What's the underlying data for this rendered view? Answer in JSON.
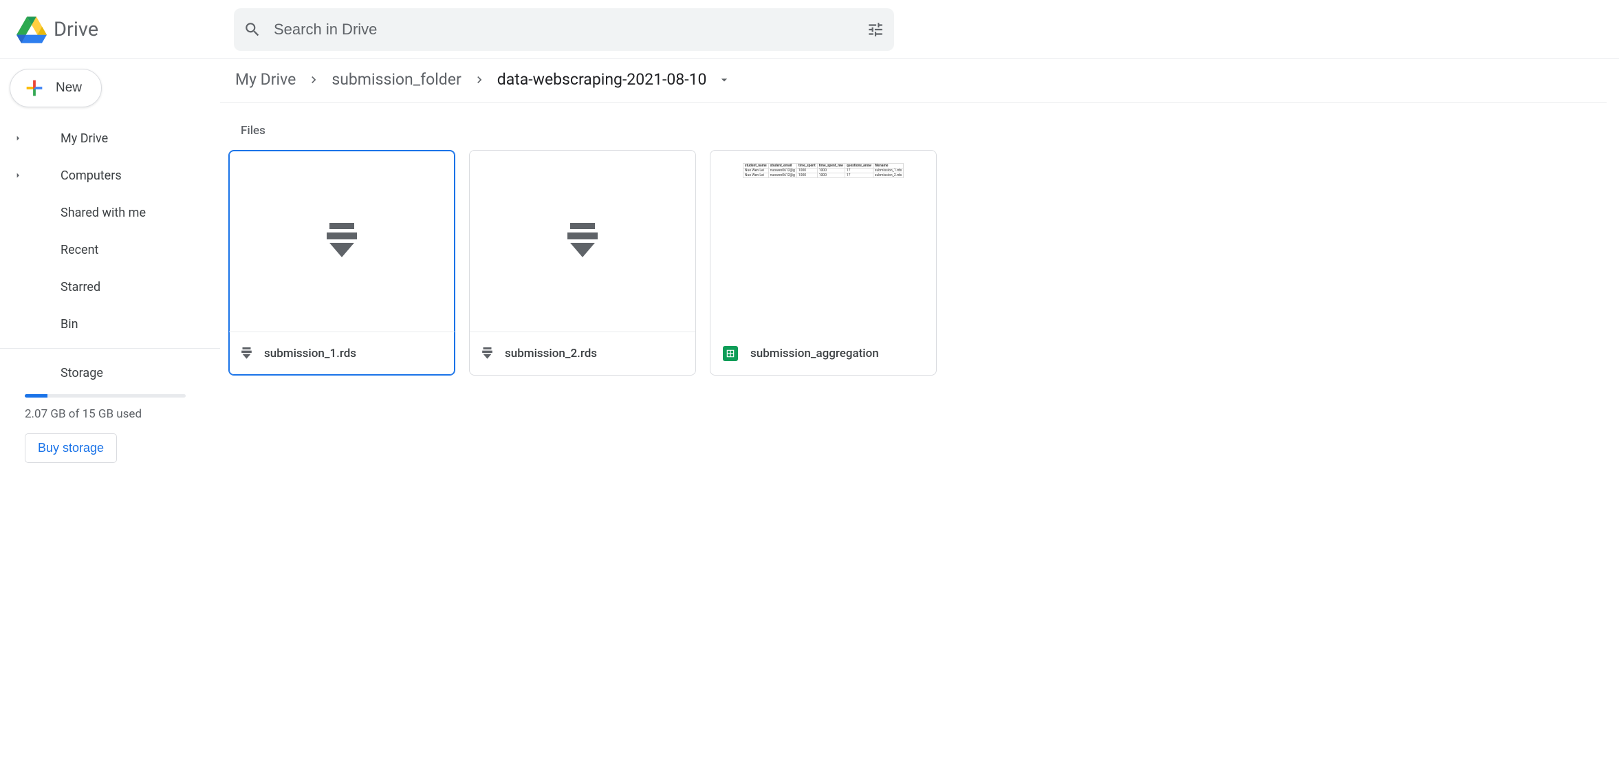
{
  "header": {
    "logo_text": "Drive",
    "search_placeholder": "Search in Drive"
  },
  "sidebar": {
    "new_label": "New",
    "items": [
      {
        "label": "My Drive",
        "icon": "mydrive",
        "expandable": true
      },
      {
        "label": "Computers",
        "icon": "computers",
        "expandable": true
      },
      {
        "label": "Shared with me",
        "icon": "shared",
        "expandable": false
      },
      {
        "label": "Recent",
        "icon": "recent",
        "expandable": false
      },
      {
        "label": "Starred",
        "icon": "starred",
        "expandable": false
      },
      {
        "label": "Bin",
        "icon": "bin",
        "expandable": false
      }
    ],
    "storage": {
      "label": "Storage",
      "used_text": "2.07 GB of 15 GB used",
      "buy_label": "Buy storage",
      "fill_percent": 14
    }
  },
  "breadcrumb": {
    "items": [
      {
        "label": "My Drive"
      },
      {
        "label": "submission_folder"
      },
      {
        "label": "data-webscraping-2021-08-10",
        "current": true
      }
    ]
  },
  "section_label": "Files",
  "files": [
    {
      "name": "submission_1.rds",
      "type": "rds",
      "selected": true
    },
    {
      "name": "submission_2.rds",
      "type": "rds",
      "selected": false
    },
    {
      "name": "submission_aggregation",
      "type": "sheets",
      "selected": false
    }
  ],
  "sheets_preview": {
    "headers": [
      "student_name",
      "student_email",
      "time_spent",
      "time_spent_raw",
      "questions_answ",
      "filename"
    ],
    "rows": [
      [
        "Nuo Wen Lei",
        "nuowen0612@g",
        "1000",
        "1000",
        "17",
        "submission_1.rds"
      ],
      [
        "Nuo Wen Lei",
        "nuowen0612@g",
        "1000",
        "1000",
        "17",
        "submission_2.rds"
      ]
    ]
  }
}
